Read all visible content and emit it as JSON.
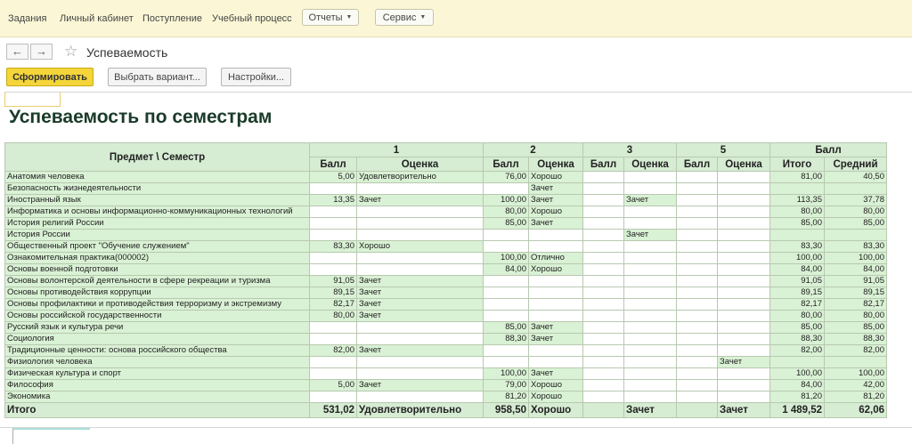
{
  "topnav": {
    "items": [
      "Задания",
      "Личный кабинет",
      "Поступление",
      "Учебный процесс"
    ],
    "reports": "Отчеты",
    "service": "Сервис"
  },
  "titlebar": {
    "title": "Успеваемость",
    "back": "←",
    "forward": "→",
    "star": "☆"
  },
  "toolbar": {
    "generate": "Сформировать",
    "variant": "Выбрать вариант...",
    "settings": "Настройки..."
  },
  "report": {
    "title": "Успеваемость по семестрам",
    "header_subject": "Предмет \\ Семестр",
    "semesters": [
      "1",
      "2",
      "3",
      "5"
    ],
    "ball_group": "Балл",
    "col_ball": "Балл",
    "col_grade": "Оценка",
    "col_total": "Итого",
    "col_avg": "Средний",
    "rows": [
      {
        "subject": "Анатомия человека",
        "s1b": "5,00",
        "s1g": "Удовлетворительно",
        "s2b": "76,00",
        "s2g": "Хорошо",
        "s3b": "",
        "s3g": "",
        "s5b": "",
        "s5g": "",
        "total": "81,00",
        "avg": "40,50"
      },
      {
        "subject": "Безопасность жизнедеятельности",
        "s1b": "",
        "s1g": "",
        "s2b": "",
        "s2g": "Зачет",
        "s3b": "",
        "s3g": "",
        "s5b": "",
        "s5g": "",
        "total": "",
        "avg": ""
      },
      {
        "subject": "Иностранный язык",
        "s1b": "13,35",
        "s1g": "Зачет",
        "s2b": "100,00",
        "s2g": "Зачет",
        "s3b": "",
        "s3g": "Зачет",
        "s5b": "",
        "s5g": "",
        "total": "113,35",
        "avg": "37,78"
      },
      {
        "subject": "Информатика и основы информационно-коммуникационных технологий",
        "s1b": "",
        "s1g": "",
        "s2b": "80,00",
        "s2g": "Хорошо",
        "s3b": "",
        "s3g": "",
        "s5b": "",
        "s5g": "",
        "total": "80,00",
        "avg": "80,00"
      },
      {
        "subject": "История религий России",
        "s1b": "",
        "s1g": "",
        "s2b": "85,00",
        "s2g": "Зачет",
        "s3b": "",
        "s3g": "",
        "s5b": "",
        "s5g": "",
        "total": "85,00",
        "avg": "85,00"
      },
      {
        "subject": "История России",
        "s1b": "",
        "s1g": "",
        "s2b": "",
        "s2g": "",
        "s3b": "",
        "s3g": "Зачет",
        "s5b": "",
        "s5g": "",
        "total": "",
        "avg": ""
      },
      {
        "subject": "Общественный проект \"Обучение служением\"",
        "s1b": "83,30",
        "s1g": "Хорошо",
        "s2b": "",
        "s2g": "",
        "s3b": "",
        "s3g": "",
        "s5b": "",
        "s5g": "",
        "total": "83,30",
        "avg": "83,30"
      },
      {
        "subject": "Ознакомительная практика(000002)",
        "s1b": "",
        "s1g": "",
        "s2b": "100,00",
        "s2g": "Отлично",
        "s3b": "",
        "s3g": "",
        "s5b": "",
        "s5g": "",
        "total": "100,00",
        "avg": "100,00"
      },
      {
        "subject": "Основы военной подготовки",
        "s1b": "",
        "s1g": "",
        "s2b": "84,00",
        "s2g": "Хорошо",
        "s3b": "",
        "s3g": "",
        "s5b": "",
        "s5g": "",
        "total": "84,00",
        "avg": "84,00"
      },
      {
        "subject": "Основы волонтерской деятельности в сфере рекреации и туризма",
        "s1b": "91,05",
        "s1g": "Зачет",
        "s2b": "",
        "s2g": "",
        "s3b": "",
        "s3g": "",
        "s5b": "",
        "s5g": "",
        "total": "91,05",
        "avg": "91,05"
      },
      {
        "subject": "Основы противодействия коррупции",
        "s1b": "89,15",
        "s1g": "Зачет",
        "s2b": "",
        "s2g": "",
        "s3b": "",
        "s3g": "",
        "s5b": "",
        "s5g": "",
        "total": "89,15",
        "avg": "89,15"
      },
      {
        "subject": "Основы профилактики и противодействия терроризму и экстремизму",
        "s1b": "82,17",
        "s1g": "Зачет",
        "s2b": "",
        "s2g": "",
        "s3b": "",
        "s3g": "",
        "s5b": "",
        "s5g": "",
        "total": "82,17",
        "avg": "82,17"
      },
      {
        "subject": "Основы российской государственности",
        "s1b": "80,00",
        "s1g": "Зачет",
        "s2b": "",
        "s2g": "",
        "s3b": "",
        "s3g": "",
        "s5b": "",
        "s5g": "",
        "total": "80,00",
        "avg": "80,00"
      },
      {
        "subject": "Русский язык и культура речи",
        "s1b": "",
        "s1g": "",
        "s2b": "85,00",
        "s2g": "Зачет",
        "s3b": "",
        "s3g": "",
        "s5b": "",
        "s5g": "",
        "total": "85,00",
        "avg": "85,00"
      },
      {
        "subject": "Социология",
        "s1b": "",
        "s1g": "",
        "s2b": "88,30",
        "s2g": "Зачет",
        "s3b": "",
        "s3g": "",
        "s5b": "",
        "s5g": "",
        "total": "88,30",
        "avg": "88,30"
      },
      {
        "subject": "Традиционные ценности: основа российского общества",
        "s1b": "82,00",
        "s1g": "Зачет",
        "s2b": "",
        "s2g": "",
        "s3b": "",
        "s3g": "",
        "s5b": "",
        "s5g": "",
        "total": "82,00",
        "avg": "82,00"
      },
      {
        "subject": "Физиология человека",
        "s1b": "",
        "s1g": "",
        "s2b": "",
        "s2g": "",
        "s3b": "",
        "s3g": "",
        "s5b": "",
        "s5g": "Зачет",
        "total": "",
        "avg": ""
      },
      {
        "subject": "Физическая культура и спорт",
        "s1b": "",
        "s1g": "",
        "s2b": "100,00",
        "s2g": "Зачет",
        "s3b": "",
        "s3g": "",
        "s5b": "",
        "s5g": "",
        "total": "100,00",
        "avg": "100,00"
      },
      {
        "subject": "Философия",
        "s1b": "5,00",
        "s1g": "Зачет",
        "s2b": "79,00",
        "s2g": "Хорошо",
        "s3b": "",
        "s3g": "",
        "s5b": "",
        "s5g": "",
        "total": "84,00",
        "avg": "42,00"
      },
      {
        "subject": "Экономика",
        "s1b": "",
        "s1g": "",
        "s2b": "81,20",
        "s2g": "Хорошо",
        "s3b": "",
        "s3g": "",
        "s5b": "",
        "s5g": "",
        "total": "81,20",
        "avg": "81,20"
      }
    ],
    "totals": {
      "subject": "Итого",
      "s1b": "531,02",
      "s1g": "Удовлетворительно",
      "s2b": "958,50",
      "s2g": "Хорошо",
      "s3b": "",
      "s3g": "Зачет",
      "s5b": "",
      "s5g": "Зачет",
      "total": "1 489,52",
      "avg": "62,06"
    }
  }
}
